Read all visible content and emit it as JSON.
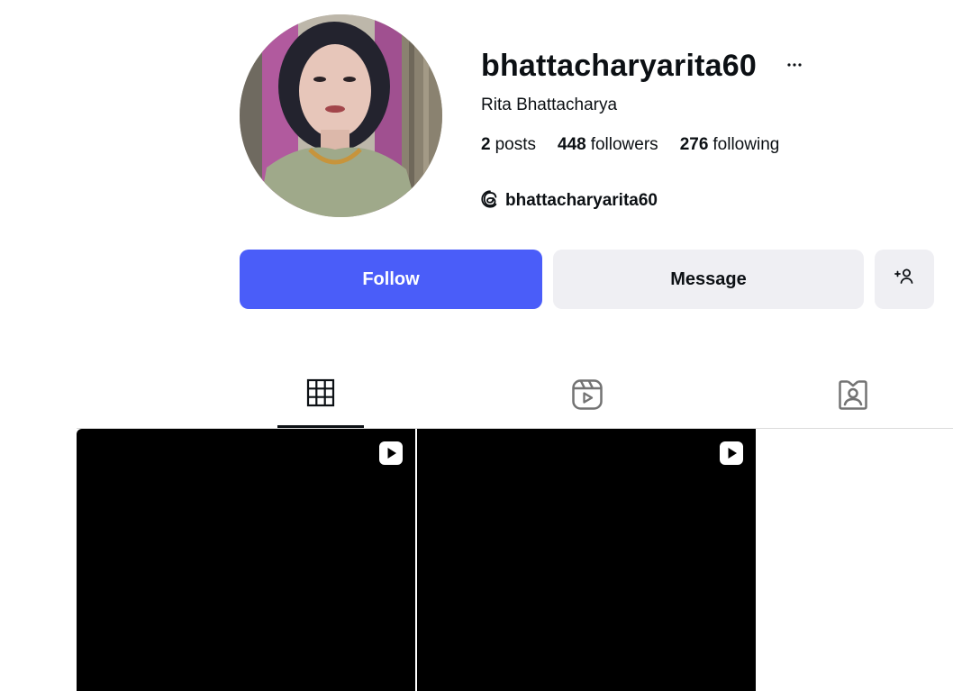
{
  "profile": {
    "username": "bhattacharyarita60",
    "full_name": "Rita Bhattacharya",
    "threads_handle": "bhattacharyarita60",
    "avatar_icon": "profile-photo"
  },
  "stats": {
    "posts_count": "2",
    "posts_label": "posts",
    "followers_count": "448",
    "followers_label": "followers",
    "following_count": "276",
    "following_label": "following"
  },
  "actions": {
    "follow_label": "Follow",
    "message_label": "Message",
    "suggest_icon": "add-person-icon",
    "more_icon": "more-options-icon"
  },
  "tabs": [
    {
      "icon": "grid-icon",
      "active": true
    },
    {
      "icon": "reels-icon",
      "active": false
    },
    {
      "icon": "tagged-icon",
      "active": false
    }
  ],
  "posts": [
    {
      "type": "reel",
      "badge_icon": "reel-play-icon"
    },
    {
      "type": "reel",
      "badge_icon": "reel-play-icon"
    }
  ],
  "colors": {
    "follow_button": "#4a5df9",
    "secondary_button": "#efeff3",
    "text": "#0c1014",
    "tile": "#000000"
  }
}
